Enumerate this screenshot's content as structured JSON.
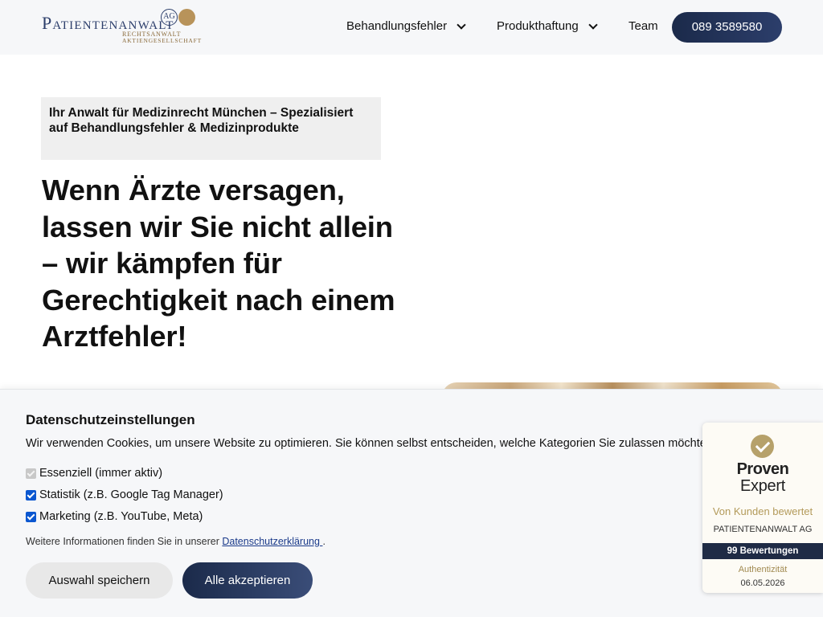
{
  "header": {
    "logo": {
      "word": "Patientenanwalt",
      "badge": "AG",
      "sub_line1": "RECHTSANWALT",
      "sub_line2": "AKTIENGESELLSCHAFT"
    },
    "nav": [
      {
        "label": "Behandlungsfehler",
        "has_dropdown": true
      },
      {
        "label": "Produkthaftung",
        "has_dropdown": true
      },
      {
        "label": "Team",
        "has_dropdown": false
      }
    ],
    "phone_button": "089 3589580"
  },
  "hero": {
    "tagline": "Ihr Anwalt für Medizinrecht München – Spezialisiert auf Behandlungsfehler & Medizinprodukte",
    "headline": "Wenn Ärzte versagen, lassen wir Sie nicht allein – wir kämpfen für Gerechtigkeit nach einem Arztfehler!"
  },
  "cookie_banner": {
    "title": "Datenschutzeinstellungen",
    "text": "Wir verwenden Cookies, um unsere Website zu optimieren. Sie können selbst entscheiden, welche Kategorien Sie zulassen möchten.",
    "options": [
      {
        "label": "Essenziell (immer aktiv)",
        "checked": true,
        "disabled": true
      },
      {
        "label": "Statistik (z.B. Google Tag Manager)",
        "checked": true,
        "disabled": false
      },
      {
        "label": "Marketing (z.B. YouTube, Meta)",
        "checked": true,
        "disabled": false
      }
    ],
    "info_prefix": "Weitere Informationen finden Sie in unserer ",
    "info_link": "Datenschutzerklärung ",
    "info_suffix": ".",
    "save_button": "Auswahl speichern",
    "accept_button": "Alle akzeptieren"
  },
  "proven_expert": {
    "brand_line1": "Proven",
    "brand_line2": "Expert",
    "rated": "Von Kunden bewertet",
    "company": "PATIENTENANWALT AG",
    "reviews": "99 Bewertungen",
    "authenticity": "Authentizität",
    "date": "06.05.2026"
  },
  "colors": {
    "brand_navy": "#1b2a4a",
    "brand_gold": "#b6a16a",
    "header_bg": "#f6f7f9",
    "checkbox_blue": "#0b57d0"
  }
}
